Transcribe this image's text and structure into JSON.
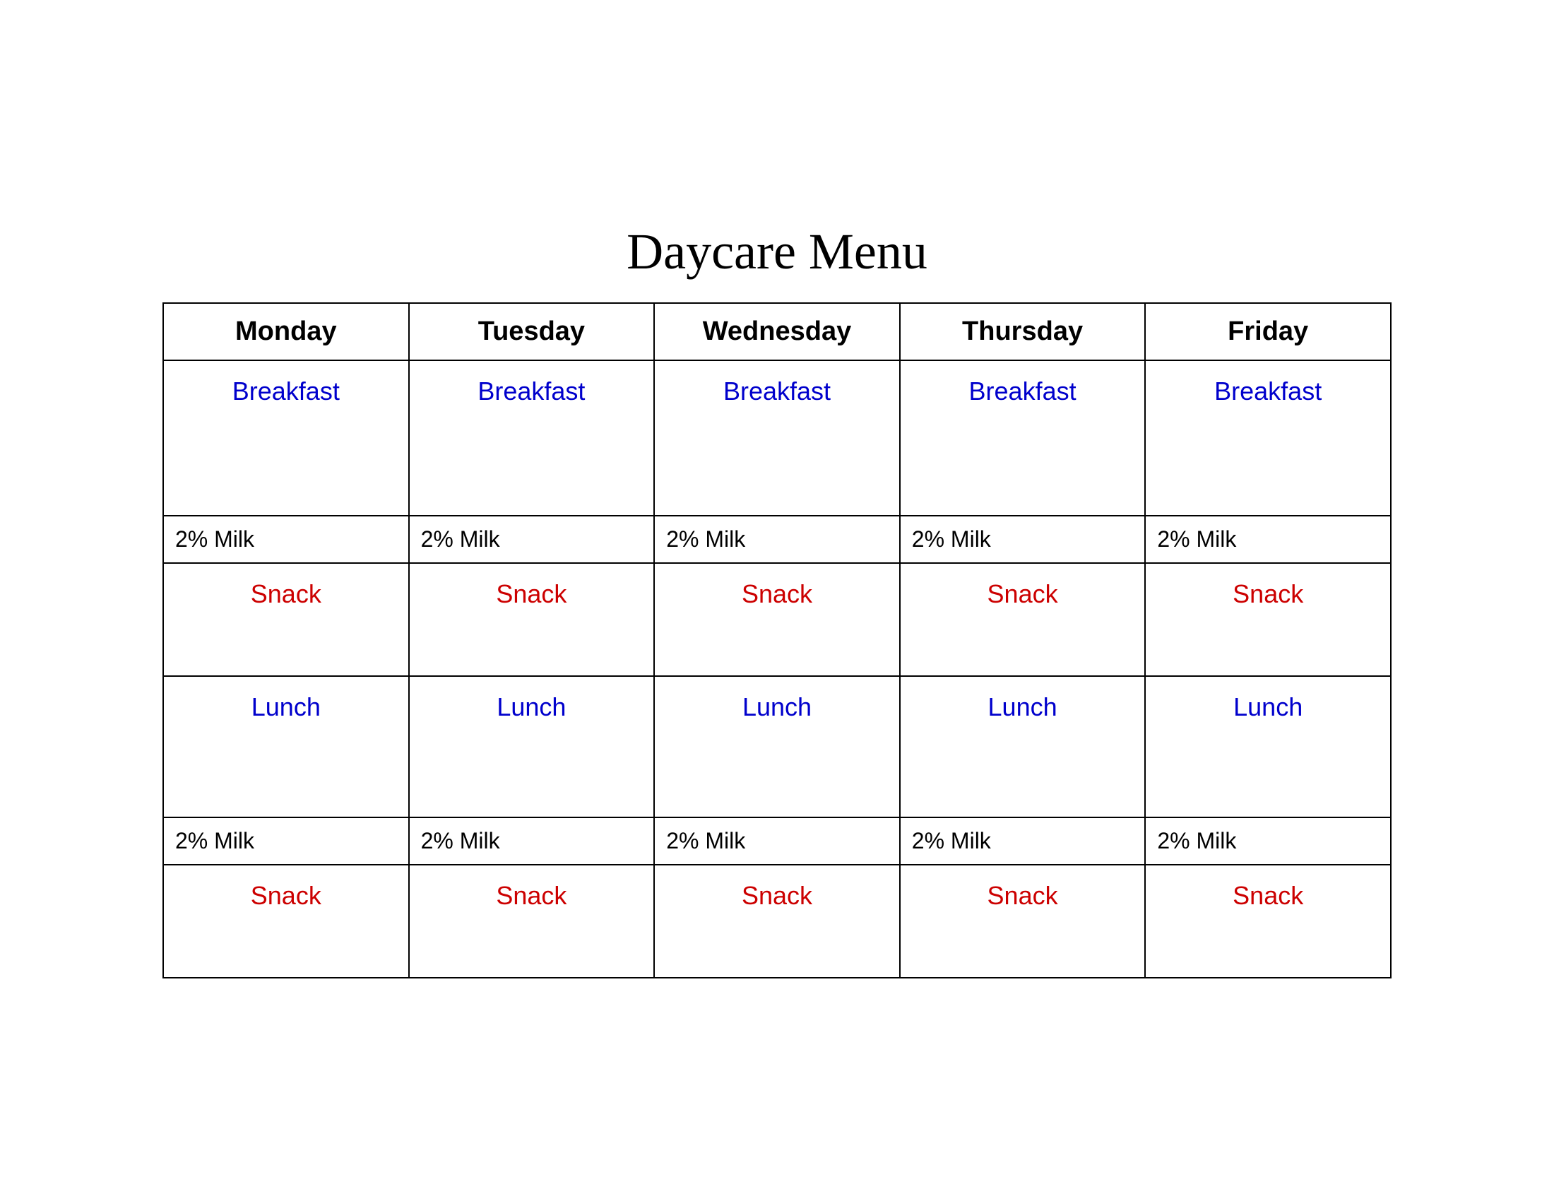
{
  "title": "Daycare Menu",
  "days": [
    "Monday",
    "Tuesday",
    "Wednesday",
    "Thursday",
    "Friday"
  ],
  "rows": {
    "breakfast_label": "Breakfast",
    "milk_label": "2% Milk",
    "snack_label": "Snack",
    "lunch_label": "Lunch",
    "milk2_label": "2% Milk",
    "snack2_label": "Snack"
  }
}
